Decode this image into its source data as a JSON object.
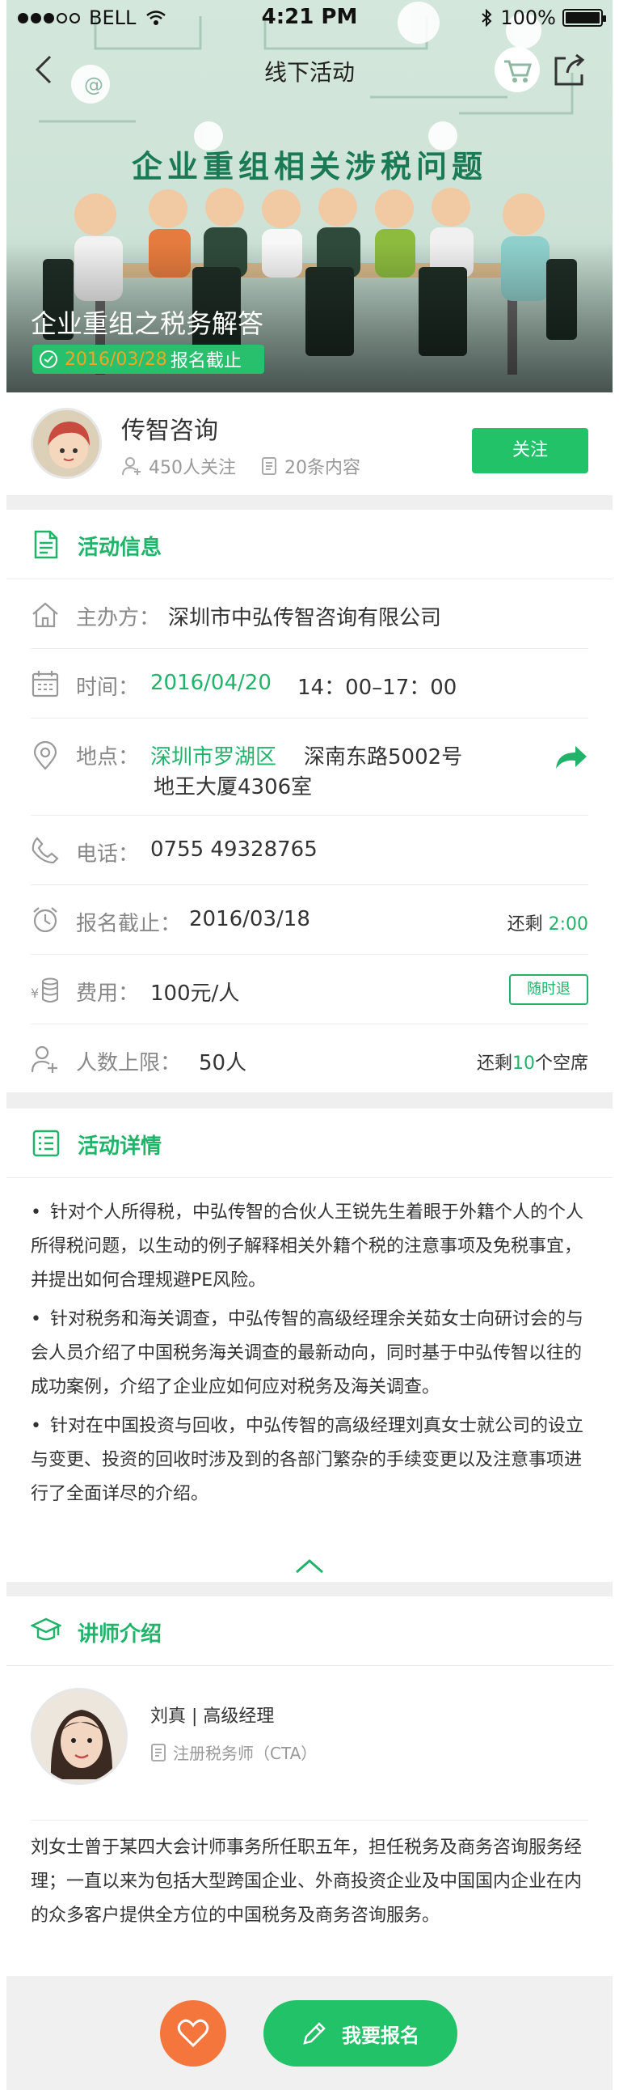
{
  "status_bar": {
    "carrier": "BELL",
    "time": "4:21 PM",
    "battery": "100%"
  },
  "nav": {
    "title": "线下活动"
  },
  "banner": {
    "heading": "企业重组相关涉税问题",
    "event_title": "企业重组之税务解答",
    "deadline_date": "2016/03/28",
    "deadline_suffix": "报名截止"
  },
  "organizer": {
    "name": "传智咨询",
    "followers": "450人关注",
    "contents": "20条内容",
    "follow_label": "关注"
  },
  "activity_info": {
    "section_title": "活动信息",
    "host_label": "主办方：",
    "host_value": "深圳市中弘传智咨询有限公司",
    "time_label": "时间：",
    "time_date": "2016/04/20",
    "time_range": "14：00–17：00",
    "location_label": "地点：",
    "location_district": "深圳市罗湖区",
    "location_street": "深南东路5002号",
    "location_building": "地王大厦4306室",
    "phone_label": "电话：",
    "phone_value": "0755 49328765",
    "deadline_label": "报名截止：",
    "deadline_value": "2016/03/18",
    "remaining_label": "还剩",
    "remaining_time": "2:00",
    "fee_label": "费用：",
    "fee_value": "100元/人",
    "refund_tag": "随时退",
    "limit_label": "人数上限：",
    "limit_value": "50人",
    "seats_prefix": "还剩",
    "seats_count": "10",
    "seats_suffix": "个空席"
  },
  "activity_detail": {
    "section_title": "活动详情",
    "bullets": [
      "针对个人所得税，中弘传智的合伙人王锐先生着眼于外籍个人的个人所得税问题，以生动的例子解释相关外籍个税的注意事项及免税事宜，并提出如何合理规避PE风险。",
      "针对税务和海关调查，中弘传智的高级经理余关茹女士向研讨会的与会人员介绍了中国税务海关调查的最新动向，同时基于中弘传智以往的成功案例，介绍了企业应如何应对税务及海关调查。",
      "针对在中国投资与回收，中弘传智的高级经理刘真女士就公司的设立与变更、投资的回收时涉及到的各部门繁杂的手续变更以及注意事项进行了全面详尽的介绍。"
    ]
  },
  "lecturer": {
    "section_title": "讲师介绍",
    "name_title": "刘真 | 高级经理",
    "certificate": "注册税务师（CTA）",
    "bio": "刘女士曾于某四大会计师事务所任职五年，担任税务及商务咨询服务经理；一直以来为包括大型跨国企业、外商投资企业及中国国内企业在内的众多客户提供全方位的中国税务及商务咨询服务。"
  },
  "bottom_bar": {
    "signup_label": "我要报名"
  },
  "colors": {
    "brand_green": "#22c268",
    "accent_orange": "#f5763c",
    "deadline_orange": "#f8a51a"
  }
}
